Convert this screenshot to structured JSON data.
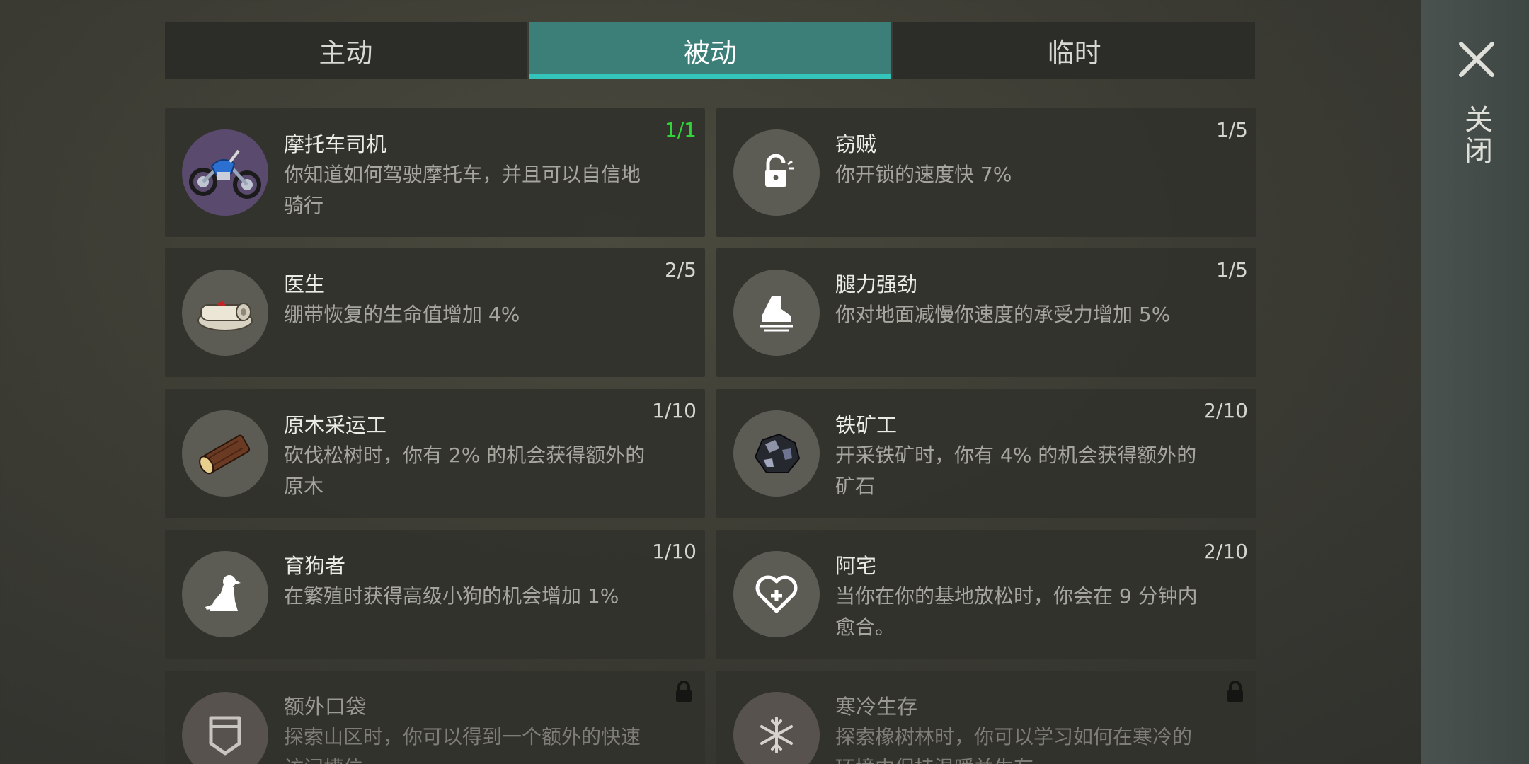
{
  "tabs": [
    {
      "label": "主动",
      "active": false
    },
    {
      "label": "被动",
      "active": true
    },
    {
      "label": "临时",
      "active": false
    }
  ],
  "close_label": "关闭",
  "accent_color": "#33c5bb",
  "skills": [
    {
      "name": "摩托车司机",
      "desc": "你知道如何驾驶摩托车，并且可以自信地骑行",
      "level": "1/1",
      "maxed": true,
      "icon": "motorcycle-icon"
    },
    {
      "name": "窃贼",
      "desc": "你开锁的速度快 7%",
      "level": "1/5",
      "icon": "unlock-icon"
    },
    {
      "name": "医生",
      "desc": "绷带恢复的生命值增加 4%",
      "level": "2/5",
      "icon": "bandage-icon"
    },
    {
      "name": "腿力强劲",
      "desc": "你对地面减慢你速度的承受力增加 5%",
      "level": "1/5",
      "icon": "boot-icon"
    },
    {
      "name": "原木采运工",
      "desc": "砍伐松树时，你有 2% 的机会获得额外的原木",
      "level": "1/10",
      "icon": "log-icon"
    },
    {
      "name": "铁矿工",
      "desc": "开采铁矿时，你有 4% 的机会获得额外的矿石",
      "level": "2/10",
      "icon": "iron-ore-icon"
    },
    {
      "name": "育狗者",
      "desc": "在繁殖时获得高级小狗的机会增加 1%",
      "level": "1/10",
      "icon": "dog-icon"
    },
    {
      "name": "阿宅",
      "desc": "当你在你的基地放松时，你会在 9 分钟内愈合。",
      "level": "2/10",
      "icon": "heart-plus-icon"
    },
    {
      "name": "额外口袋",
      "desc": "探索山区时，你可以得到一个额外的快速访问槽位",
      "locked": true,
      "icon": "pocket-icon"
    },
    {
      "name": "寒冷生存",
      "desc": "探索橡树林时，你可以学习如何在寒冷的环境中保持温暖并生存",
      "locked": true,
      "icon": "snowflake-icon"
    }
  ]
}
